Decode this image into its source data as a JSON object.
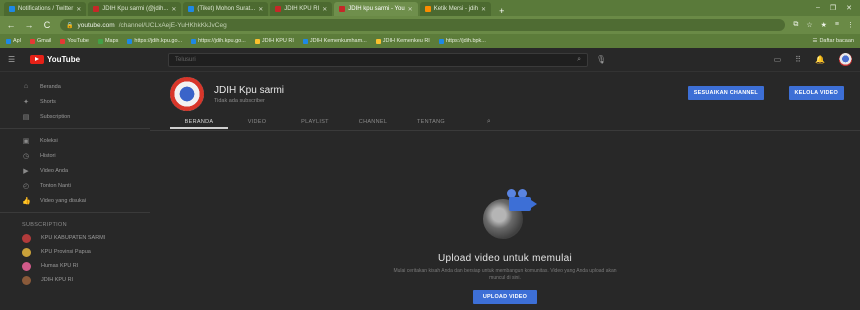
{
  "browser": {
    "tabs": [
      {
        "label": "Notifications / Twitter",
        "fav": "blue",
        "active": false
      },
      {
        "label": "JDIH Kpu sarmi (@jdih...",
        "fav": "red",
        "active": false
      },
      {
        "label": "(Tiket) Mohon Surat...",
        "fav": "blue",
        "active": false
      },
      {
        "label": "JDIH KPU RI",
        "fav": "red",
        "active": false
      },
      {
        "label": "JDIH kpu sarmi - You",
        "fav": "red",
        "active": true
      },
      {
        "label": "Ketik Mersi - jdih",
        "fav": "orange",
        "active": false
      }
    ],
    "new_tab": "+",
    "window_controls": [
      "–",
      "❐",
      "✕"
    ],
    "url_host": "youtube.com",
    "url_path": "/channel/UCLxAejE-YuHKhkKkJvCeg",
    "nav_back": "←",
    "nav_forward": "→",
    "nav_reload": "C",
    "addr_actions": [
      "⧉",
      "☆",
      "★",
      "≡",
      "⋮"
    ],
    "bookmarks": [
      {
        "label": "Apl",
        "color": "b"
      },
      {
        "label": "Gmail",
        "color": "r"
      },
      {
        "label": "YouTube",
        "color": "r"
      },
      {
        "label": "Maps",
        "color": "g"
      },
      {
        "label": "https://jdih.kpu.go...",
        "color": "b"
      },
      {
        "label": "https://jdih.kpu.go...",
        "color": "b"
      },
      {
        "label": "JDIH KPU RI",
        "color": "y"
      },
      {
        "label": "JDIH Kemenkumham...",
        "color": "b"
      },
      {
        "label": "JDIH Kemenkeu RI",
        "color": "y"
      },
      {
        "label": "https://jdih.bpk...",
        "color": "b"
      }
    ],
    "bookmarks_right": "Daftar bacaan"
  },
  "youtube": {
    "logo_text": "YouTube",
    "search_placeholder": "Telusuri",
    "sidebar": {
      "items": [
        {
          "icon": "⌂",
          "label": "Beranda",
          "name": "home"
        },
        {
          "icon": "✦",
          "label": "Shorts",
          "name": "shorts"
        },
        {
          "icon": "▤",
          "label": "Subscription",
          "name": "subscriptions"
        }
      ],
      "items2": [
        {
          "icon": "▣",
          "label": "Koleksi",
          "name": "library"
        },
        {
          "icon": "◷",
          "label": "Histori",
          "name": "history"
        },
        {
          "icon": "▶",
          "label": "Video Anda",
          "name": "your-videos"
        },
        {
          "icon": "◴",
          "label": "Tonton Nanti",
          "name": "watch-later"
        },
        {
          "icon": "👍",
          "label": "Video yang disukai",
          "name": "liked-videos"
        }
      ],
      "subscription_heading": "SUBSCRIPTION",
      "subscriptions": [
        {
          "label": "KPU KABUPATEN SARMI",
          "color": ""
        },
        {
          "label": "KPU Provinsi Papua",
          "color": "b"
        },
        {
          "label": "Humas KPU RI",
          "color": "c"
        },
        {
          "label": "JDIH KPU RI",
          "color": "d"
        }
      ]
    },
    "channel": {
      "name": "JDIH Kpu sarmi",
      "subscribers": "Tidak ada subscriber",
      "customize_label": "SESUAIKAN CHANNEL",
      "manage_label": "KELOLA VIDEO",
      "tabs": [
        "BERANDA",
        "VIDEO",
        "PLAYLIST",
        "CHANNEL",
        "TENTANG"
      ],
      "active_tab": 0
    },
    "empty_state": {
      "title": "Upload video untuk memulai",
      "description": "Mulai ceritakan kisah Anda dan bersiap untuk membangun komunitas. Video yang Anda upload akan muncul di sini.",
      "button": "UPLOAD VIDEO"
    }
  },
  "colors": {
    "accent_blue": "#3d6fd6",
    "youtube_red": "#e62117",
    "browser_frame": "#6a8a46"
  }
}
